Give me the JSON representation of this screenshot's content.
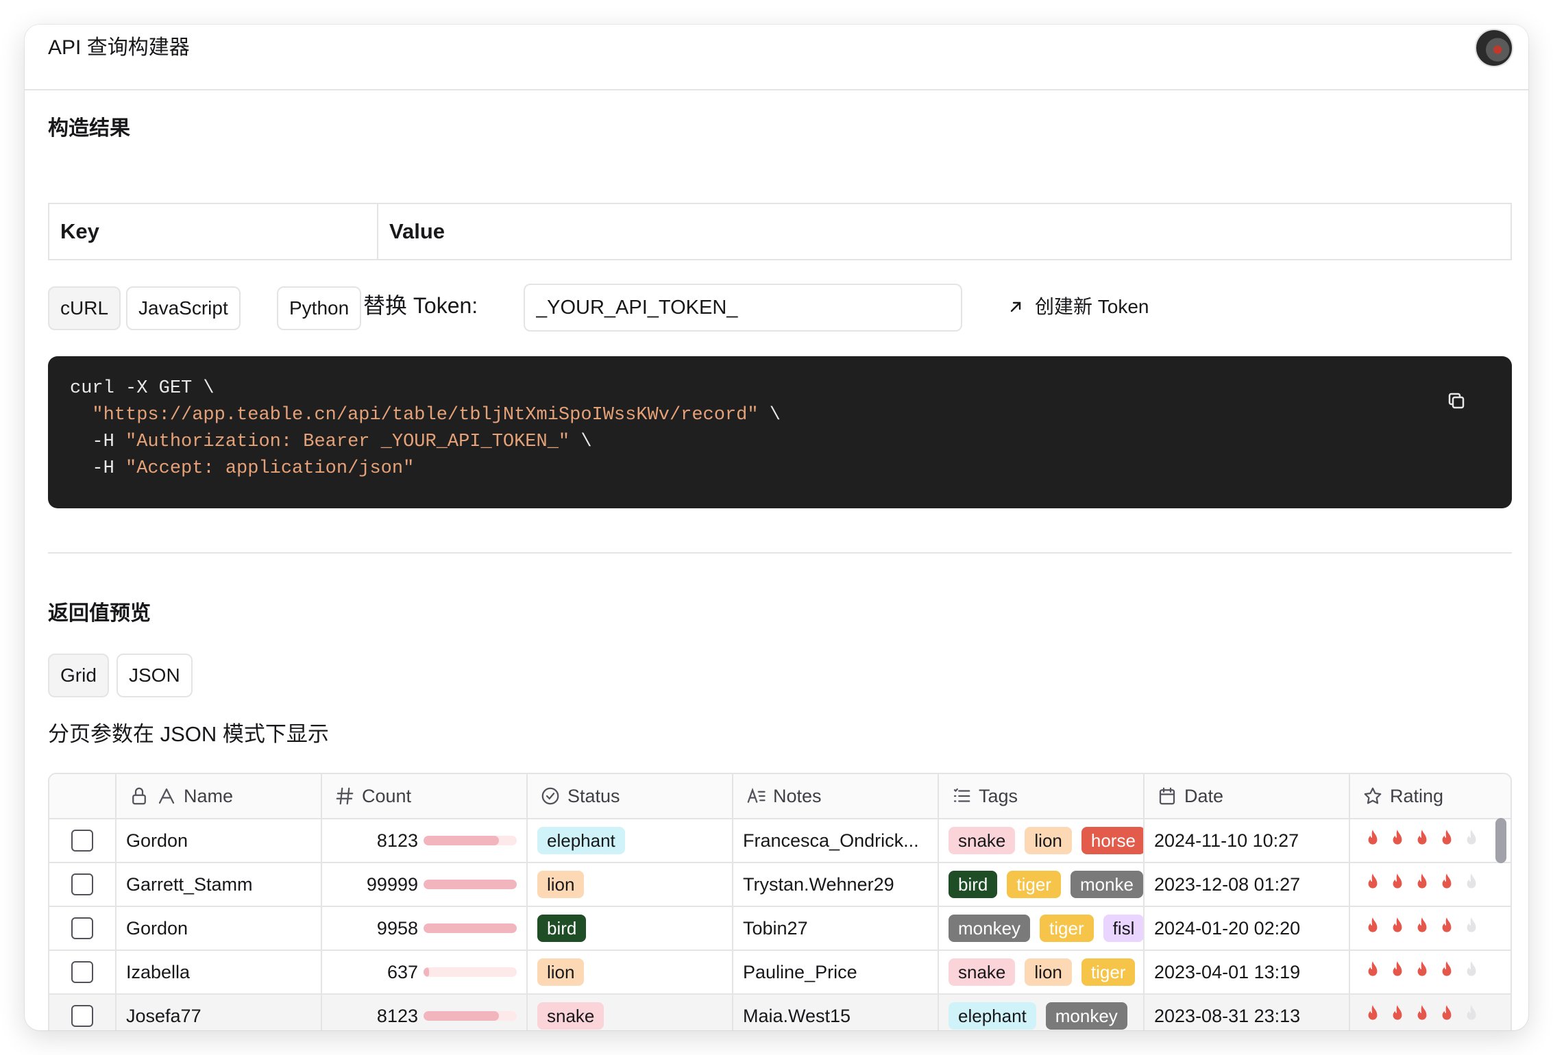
{
  "header": {
    "title": "API 查询构建器"
  },
  "build": {
    "title": "构造结果",
    "key_header": "Key",
    "value_header": "Value"
  },
  "lang_tabs": {
    "curl": "cURL",
    "javascript": "JavaScript",
    "python": "Python"
  },
  "token": {
    "label": "替换 Token:",
    "value": "_YOUR_API_TOKEN_",
    "new_token_link": "创建新 Token"
  },
  "code": {
    "line1": "curl -X GET \\",
    "line2_str": "\"https://app.teable.cn/api/table/tbljNtXmiSpoIWssKWv/record\"",
    "line2_end": " \\",
    "line3_pre": "  -H ",
    "line3_str": "\"Authorization: Bearer _YOUR_API_TOKEN_\"",
    "line3_end": " \\",
    "line4_pre": "  -H ",
    "line4_str": "\"Accept: application/json\""
  },
  "preview": {
    "title": "返回值预览",
    "grid_tab": "Grid",
    "json_tab": "JSON",
    "note": "分页参数在 JSON 模式下显示"
  },
  "grid": {
    "columns": [
      "Name",
      "Count",
      "Status",
      "Notes",
      "Tags",
      "Date",
      "Rating"
    ],
    "rows": [
      {
        "name": "Gordon",
        "count": "8123",
        "count_fraction": 0.81,
        "status": "elephant",
        "notes": "Francesca_Ondrick...",
        "tags": [
          "snake",
          "lion",
          "horse"
        ],
        "date": "2024-11-10 10:27",
        "rating": 4
      },
      {
        "name": "Garrett_Stamm",
        "count": "99999",
        "count_fraction": 1.0,
        "status": "lion",
        "notes": "Trystan.Wehner29",
        "tags": [
          "bird",
          "tiger",
          "monke"
        ],
        "date": "2023-12-08 01:27",
        "rating": 4
      },
      {
        "name": "Gordon",
        "count": "9958",
        "count_fraction": 1.0,
        "status": "bird",
        "notes": "Tobin27",
        "tags": [
          "monkey",
          "tiger",
          "fisl"
        ],
        "date": "2024-01-20 02:20",
        "rating": 4
      },
      {
        "name": "Izabella",
        "count": "637",
        "count_fraction": 0.06,
        "status": "lion",
        "notes": "Pauline_Price",
        "tags": [
          "snake",
          "lion",
          "tiger"
        ],
        "date": "2023-04-01 13:19",
        "rating": 4
      },
      {
        "name": "Josefa77",
        "count": "8123",
        "count_fraction": 0.81,
        "status": "snake",
        "notes": "Maia.West15",
        "tags": [
          "elephant",
          "monkey"
        ],
        "date": "2023-08-31 23:13",
        "rating": 4
      }
    ]
  },
  "tag_colors": {
    "elephant": {
      "bg": "#cff3f9",
      "fg": "#18181b"
    },
    "lion": {
      "bg": "#fcd9b4",
      "fg": "#18181b"
    },
    "bird": {
      "bg": "#1e4d26",
      "fg": "#ffffff"
    },
    "snake": {
      "bg": "#fbd4d9",
      "fg": "#18181b"
    },
    "horse": {
      "bg": "#e35b4b",
      "fg": "#ffffff"
    },
    "tiger": {
      "bg": "#f6c448",
      "fg": "#ffffff"
    },
    "monkey": {
      "bg": "#7a7a7a",
      "fg": "#ffffff"
    },
    "monke": {
      "bg": "#7a7a7a",
      "fg": "#ffffff"
    },
    "fisl": {
      "bg": "#e9d5ff",
      "fg": "#18181b"
    }
  },
  "colors": {
    "flame": "#e4574a",
    "flame_empty": "#e4e4e7",
    "code_bg": "#1f1f1f",
    "code_string": "#e5a178"
  }
}
